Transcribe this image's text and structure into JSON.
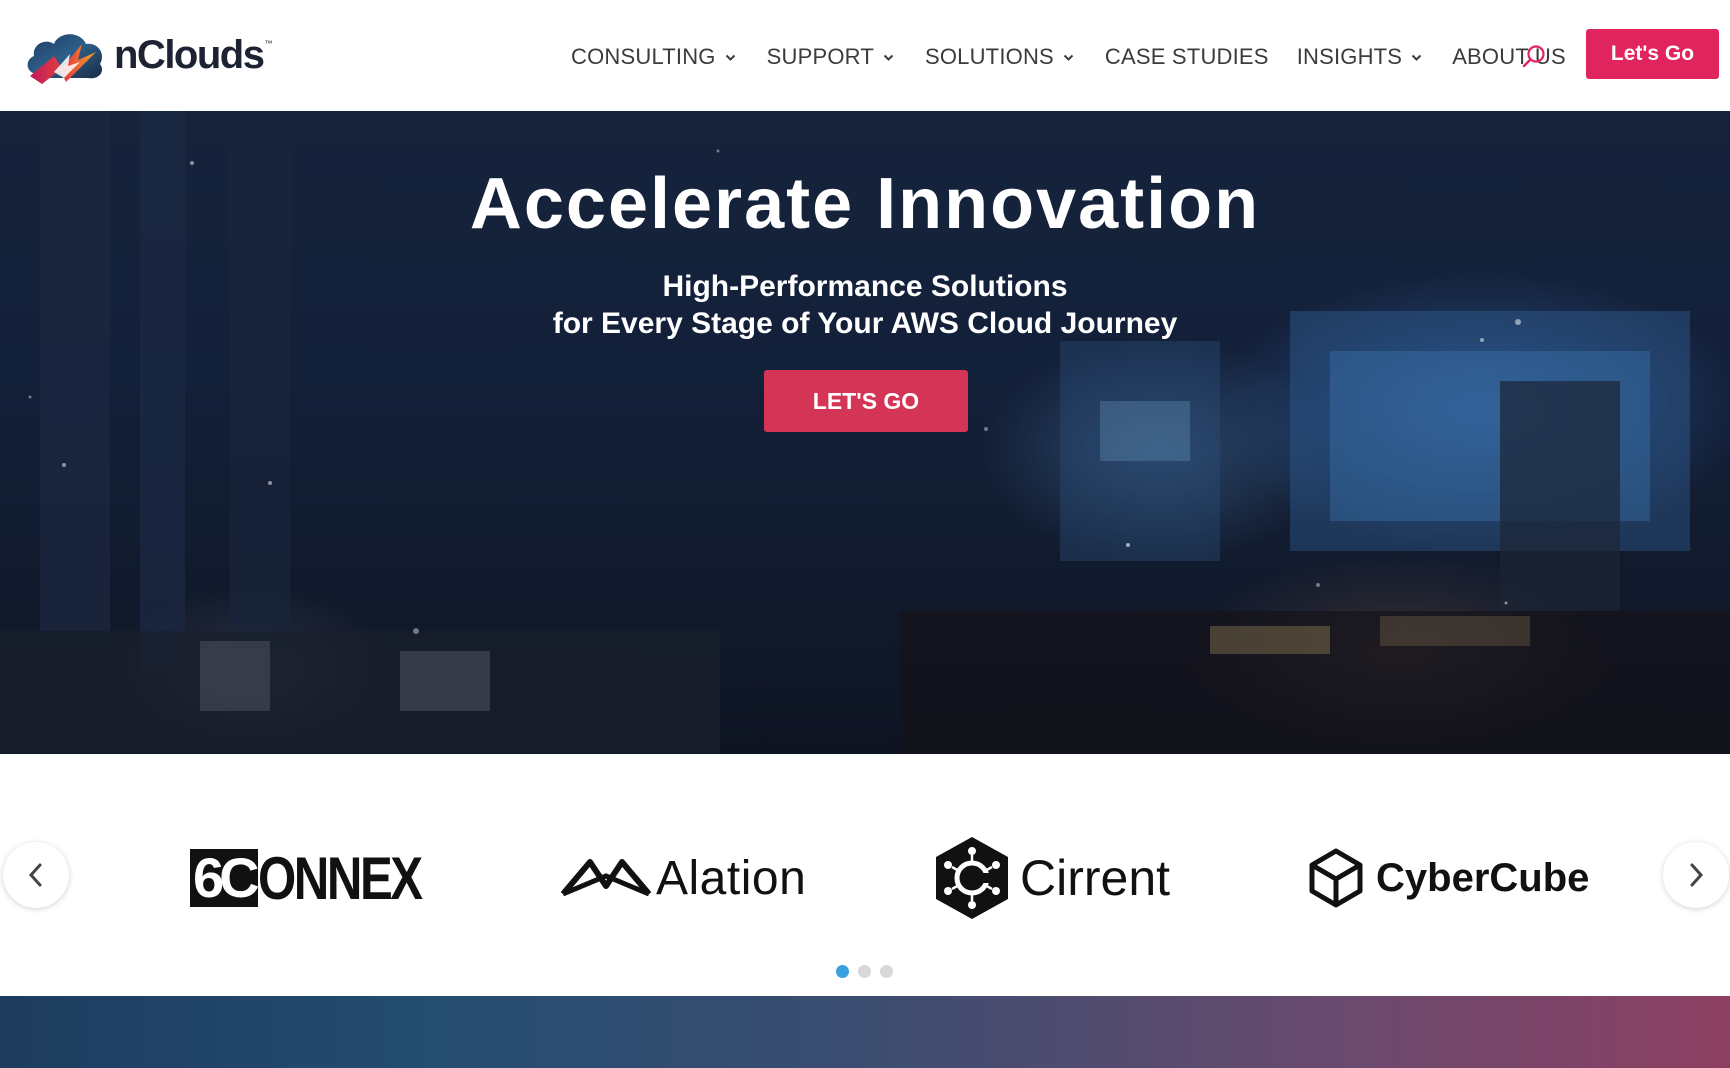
{
  "header": {
    "brand": "nClouds",
    "brand_tm": "™",
    "nav": [
      {
        "label": "CONSULTING",
        "has_dropdown": true
      },
      {
        "label": "SUPPORT",
        "has_dropdown": true
      },
      {
        "label": "SOLUTIONS",
        "has_dropdown": true
      },
      {
        "label": "CASE STUDIES",
        "has_dropdown": false
      },
      {
        "label": "INSIGHTS",
        "has_dropdown": true
      },
      {
        "label": "ABOUT US",
        "has_dropdown": false
      }
    ],
    "search_icon": "search-icon",
    "cta_label": "Let's Go"
  },
  "hero": {
    "title": "Accelerate Innovation",
    "subtitle_line1": "High-Performance Solutions",
    "subtitle_line2": "for Every Stage of Your AWS Cloud Journey",
    "cta_label": "LET'S GO"
  },
  "clients": {
    "logos": [
      {
        "name": "6CONNEX",
        "prefix": "6C",
        "rest": "ONNEX"
      },
      {
        "name": "Alation",
        "text": "Alation"
      },
      {
        "name": "Cirrent",
        "text": "Cirrent"
      },
      {
        "name": "CyberCube",
        "text": "CyberCube"
      }
    ],
    "prev_icon": "chevron-left-icon",
    "next_icon": "chevron-right-icon",
    "pagination": {
      "total": 3,
      "active": 1
    }
  },
  "colors": {
    "accent": "#e0245e",
    "hero_button": "#d43455",
    "nav_text": "#3b3b3b",
    "dot_active": "#3aa0e0"
  }
}
